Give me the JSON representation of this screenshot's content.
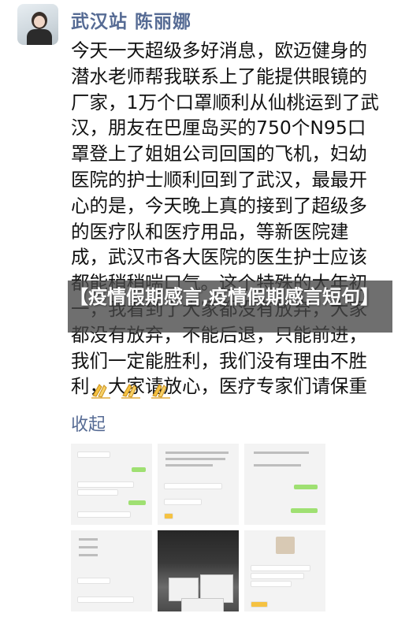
{
  "post": {
    "author": "武汉站 陈丽娜",
    "content": "今天一天超级多好消息，欧迈健身的潜水老师帮我联系上了能提供眼镜的厂家，1万个口罩顺利从仙桃运到了武汉，朋友在巴厘岛买的750个N95口罩登上了姐姐公司回国的飞机，妇幼医院的护士顺利回到了武汉，最最开心的是，今天晚上真的接到了超级多的医疗队和医疗用品，等新医院建成，武汉市各大医院的医生护士应该都能稍稍喘口气。这个特殊的大年初一，我看到了大家都没有放弃，大家都没有放弃，不能后退，只能前进，我们一定能胜利，我们没有理由不胜利，大家请放心，医疗专家们请保重",
    "collapse_label": "收起"
  },
  "overlay": {
    "title": "【疫情假期感言,疫情假期感言短句】"
  },
  "thumbnails": {
    "t1": {
      "lines": [
        "我的同一下",
        "口罩公司领导刚联系上，公司招",
        "你们看了吗",
        "口罩医务人员已经领到，还差"
      ],
      "footer": "本人你是武汉"
    },
    "t2": {
      "lines": [
        "我现在已经在联系中，",
        "三医院的打开来了吗",
        "n95一个也没有了"
      ],
      "footer": ""
    },
    "t3": {
      "lines": [
        "你好在不在",
        "没事啦",
        "好好"
      ],
      "footer": ""
    },
    "t4": {
      "lines": [
        "我们这里",
        "有没有",
        "她们都在"
      ],
      "footer": "你好，被我消息之力"
    },
    "t6": {
      "lines": [
        "现在的情况是已经",
        "物资已经就位",
        "谢谢大家"
      ],
      "footer": ""
    }
  },
  "colors": {
    "name_blue": "#566b94",
    "bubble_green": "#9fe072",
    "clap_yellow": "#f5c242"
  }
}
